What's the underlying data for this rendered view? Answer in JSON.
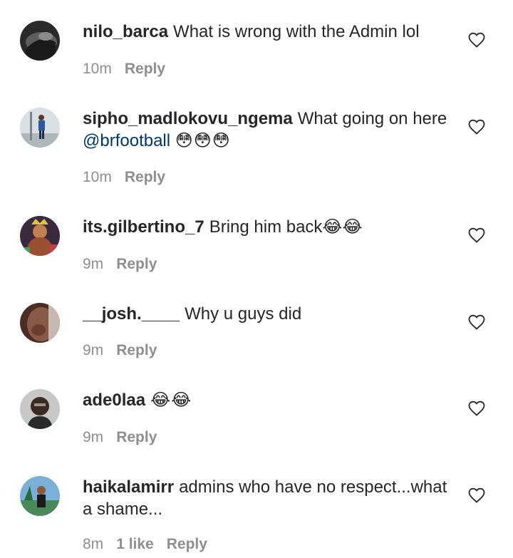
{
  "comments": [
    {
      "username": "nilo_barca",
      "text": "What is wrong with the Admin lol",
      "time": "10m",
      "reply": "Reply",
      "avatar_color": "#3c3c3c"
    },
    {
      "username": "sipho_madlokovu_ngema",
      "text": "What going on here",
      "mention": "@brfootball",
      "emoji": "😳😳😳",
      "time": "10m",
      "reply": "Reply",
      "avatar_color": "#c8d2d8"
    },
    {
      "username": "its.gilbertino_7",
      "text": "Bring him back😂😂",
      "time": "9m",
      "reply": "Reply",
      "avatar_color": "#5a3a2a"
    },
    {
      "username": "__josh.____",
      "text": "Why u guys did",
      "time": "9m",
      "reply": "Reply",
      "avatar_color": "#7a5040"
    },
    {
      "username": "ade0laa",
      "text": "😂😂",
      "time": "9m",
      "reply": "Reply",
      "avatar_color": "#b0b0b0"
    },
    {
      "username": "haikalamirr",
      "text": "admins who have no respect...what a shame...",
      "time": "8m",
      "likes": "1 like",
      "reply": "Reply",
      "avatar_color": "#6aa0c8"
    }
  ],
  "colors": {
    "text": "#262626",
    "meta": "#8e8e8e",
    "mention": "#00376b",
    "background": "#ffffff"
  },
  "icons": {
    "like": "heart-outline-icon"
  }
}
